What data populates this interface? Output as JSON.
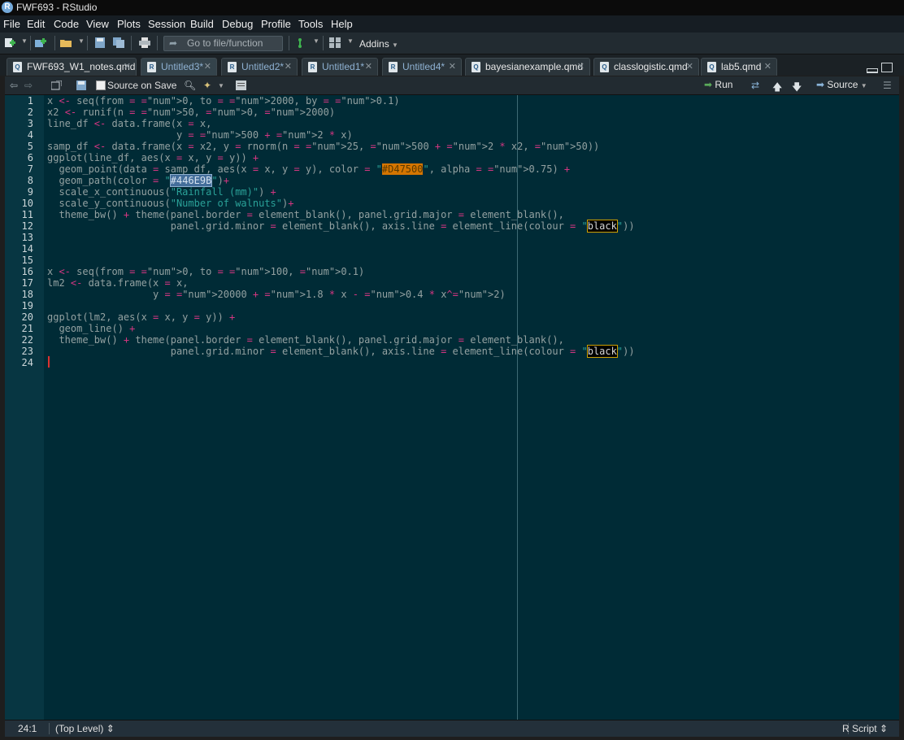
{
  "window": {
    "title": "FWF693 - RStudio"
  },
  "menu": [
    "File",
    "Edit",
    "Code",
    "View",
    "Plots",
    "Session",
    "Build",
    "Debug",
    "Profile",
    "Tools",
    "Help"
  ],
  "toolbar": {
    "goto_placeholder": "Go to file/function",
    "addins_label": "Addins"
  },
  "tabs": [
    {
      "label": "FWF693_W1_notes.qmd",
      "active": false,
      "unsaved": false
    },
    {
      "label": "Untitled3*",
      "active": true,
      "unsaved": true
    },
    {
      "label": "Untitled2*",
      "active": false,
      "unsaved": true
    },
    {
      "label": "Untitled1*",
      "active": false,
      "unsaved": true
    },
    {
      "label": "Untitled4*",
      "active": false,
      "unsaved": true
    },
    {
      "label": "bayesianexample.qmd",
      "active": false,
      "unsaved": false
    },
    {
      "label": "classlogistic.qmd",
      "active": false,
      "unsaved": false
    },
    {
      "label": "lab5.qmd",
      "active": false,
      "unsaved": false
    }
  ],
  "editor_toolbar": {
    "source_on_save_label": "Source on Save",
    "run_label": "Run",
    "source_label": "Source"
  },
  "editor": {
    "line_numbers": [
      "1",
      "2",
      "3",
      "4",
      "5",
      "6",
      "7",
      "8",
      "9",
      "10",
      "11",
      "12",
      "13",
      "14",
      "15",
      "16",
      "17",
      "18",
      "19",
      "20",
      "21",
      "22",
      "23",
      "24"
    ],
    "lines": [
      "x <- seq(from = 0, to = 2000, by = 0.1)",
      "x2 <- runif(n = 50, 0, 2000)",
      "line_df <- data.frame(x = x,",
      "                      y = 500 + 2 * x)",
      "samp_df <- data.frame(x = x2, y = rnorm(n = 25, 500 + 2 * x2, 50))",
      "ggplot(line_df, aes(x = x, y = y)) +",
      "  geom_point(data = samp_df, aes(x = x, y = y), color = \"#D47500\", alpha = 0.75) +",
      "  geom_path(color = \"#446E9B\")+",
      "  scale_x_continuous(\"Rainfall (mm)\") +",
      "  scale_y_continuous(\"Number of walnuts\")+",
      "  theme_bw() + theme(panel.border = element_blank(), panel.grid.major = element_blank(),",
      "                     panel.grid.minor = element_blank(), axis.line = element_line(colour = \"black\"))",
      "",
      "",
      "",
      "x <- seq(from = 0, to = 100, 0.1)",
      "lm2 <- data.frame(x = x,",
      "                  y = 20000 + 1.8 * x - 0.4 * x^2)",
      "",
      "ggplot(lm2, aes(x = x, y = y)) +",
      "  geom_line() +",
      "  theme_bw() + theme(panel.border = element_blank(), panel.grid.major = element_blank(),",
      "                     panel.grid.minor = element_blank(), axis.line = element_line(colour = \"black\"))",
      ""
    ]
  },
  "status": {
    "cursor_pos": "24:1",
    "scope": "(Top Level) ⇕",
    "file_type": "R Script ⇕"
  },
  "colors": {
    "editor_bg": "#002b36",
    "number": "#d33682",
    "string": "#2aa198",
    "highlight_orange": "#D47500",
    "highlight_blue": "#446E9B"
  }
}
